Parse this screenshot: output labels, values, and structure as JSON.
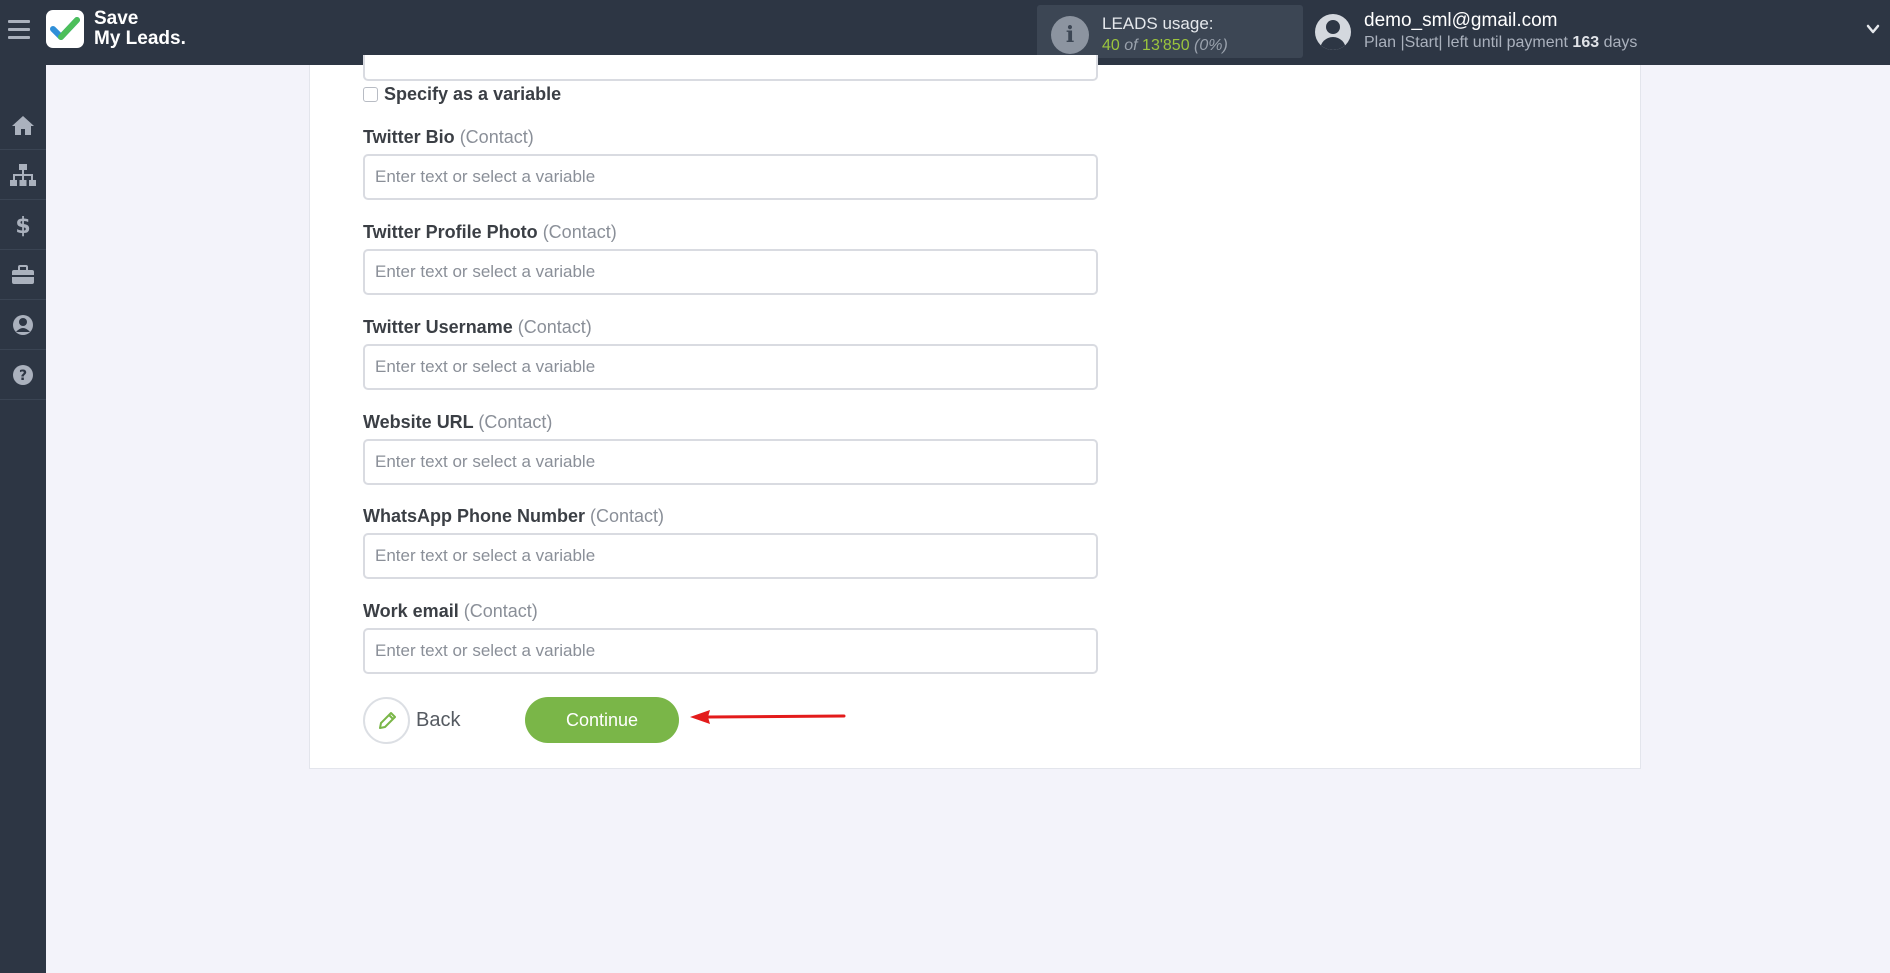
{
  "brand": {
    "line1": "Save",
    "line2": "My Leads."
  },
  "leads": {
    "title": "LEADS usage:",
    "used": "40",
    "of": "of",
    "total": "13'850",
    "percent": "(0%)"
  },
  "user": {
    "email": "demo_sml@gmail.com",
    "plan_prefix": "Plan |Start| left until payment",
    "days_number": "163",
    "days_suffix": "days"
  },
  "sidebar": {
    "items": [
      "home-icon",
      "sitemap-icon",
      "dollar-icon",
      "briefcase-icon",
      "user-circle-icon",
      "question-circle-icon"
    ]
  },
  "form": {
    "specify_variable": "Specify as a variable",
    "fields": [
      {
        "label": "Twitter Bio",
        "sub": "(Contact)",
        "placeholder": "Enter text or select a variable"
      },
      {
        "label": "Twitter Profile Photo",
        "sub": "(Contact)",
        "placeholder": "Enter text or select a variable"
      },
      {
        "label": "Twitter Username",
        "sub": "(Contact)",
        "placeholder": "Enter text or select a variable"
      },
      {
        "label": "Website URL",
        "sub": "(Contact)",
        "placeholder": "Enter text or select a variable"
      },
      {
        "label": "WhatsApp Phone Number",
        "sub": "(Contact)",
        "placeholder": "Enter text or select a variable"
      },
      {
        "label": "Work email",
        "sub": "(Contact)",
        "placeholder": "Enter text or select a variable"
      }
    ],
    "back_label": "Back",
    "continue_label": "Continue"
  },
  "colors": {
    "topbar": "#2d3644",
    "accent": "#7ab648",
    "arrow": "#e31b1b"
  }
}
